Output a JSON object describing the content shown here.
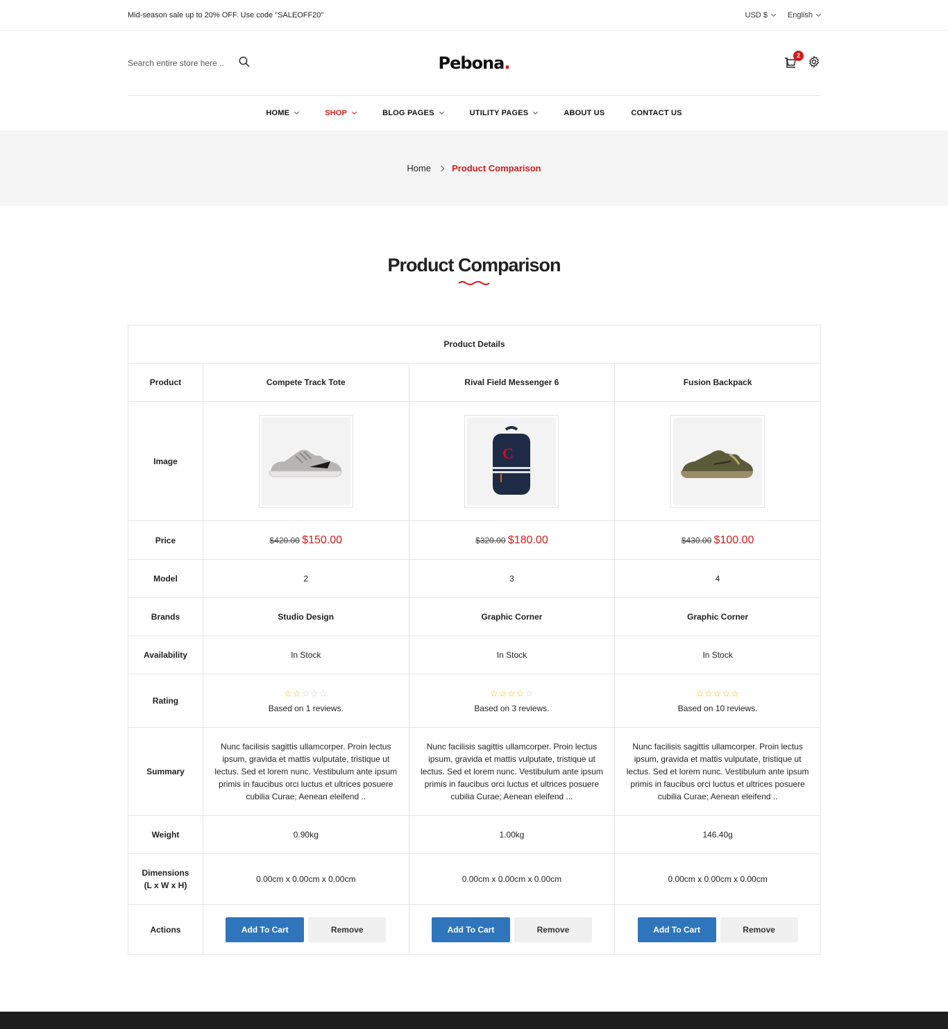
{
  "topbar": {
    "promo": "Mid-season sale up to 20% OFF. Use code \"SALEOFF20\"",
    "currency": "USD $",
    "language": "English"
  },
  "header": {
    "search_placeholder": "Search entire store here ...",
    "logo_text": "Pebona",
    "logo_dot": ".",
    "cart_count": "2"
  },
  "nav": {
    "items": [
      {
        "label": "HOME"
      },
      {
        "label": "SHOP"
      },
      {
        "label": "BLOG PAGES"
      },
      {
        "label": "UTILITY PAGES"
      },
      {
        "label": "ABOUT US"
      },
      {
        "label": "CONTACT US"
      }
    ]
  },
  "breadcrumb": {
    "home": "Home",
    "current": "Product Comparison"
  },
  "page": {
    "title": "Product Comparison"
  },
  "table": {
    "heading": "Product Details",
    "labels": {
      "product": "Product",
      "image": "Image",
      "price": "Price",
      "model": "Model",
      "brands": "Brands",
      "availability": "Availability",
      "rating": "Rating",
      "summary": "Summary",
      "weight": "Weight",
      "dimensions_1": "Dimensions",
      "dimensions_2": "(L x W x H)",
      "actions": "Actions"
    },
    "products": [
      {
        "name": "Compete Track Tote",
        "image": "grey-sneaker",
        "old_price": "$420.00",
        "price": "$150.00",
        "model": "2",
        "brand": "Studio Design",
        "availability": "In Stock",
        "rating": 2,
        "reviews": "Based on 1 reviews.",
        "summary": "Nunc facilisis sagittis ullamcorper. Proin lectus ipsum, gravida et mattis vulputate, tristique ut lectus. Sed et lorem nunc. Vestibulum ante ipsum primis in faucibus orci luctus et ultrices posuere cubilia Curae; Aenean eleifend ..",
        "weight": "0.90kg",
        "dimensions": "0.00cm x 0.00cm x 0.00cm",
        "add_label": "Add To Cart",
        "remove_label": "Remove"
      },
      {
        "name": "Rival Field Messenger 6",
        "image": "navy-backpack",
        "old_price": "$320.00",
        "price": "$180.00",
        "model": "3",
        "brand": "Graphic Corner",
        "availability": "In Stock",
        "rating": 4,
        "reviews": "Based on 3 reviews.",
        "summary": "Nunc facilisis sagittis ullamcorper. Proin lectus ipsum, gravida et mattis vulputate, tristique ut lectus. Sed et lorem nunc. Vestibulum ante ipsum primis in faucibus orci luctus et ultrices posuere cubilia Curae; Aenean eleifend ...",
        "weight": "1.00kg",
        "dimensions": "0.00cm x 0.00cm x 0.00cm",
        "add_label": "Add To Cart",
        "remove_label": "Remove"
      },
      {
        "name": "Fusion Backpack",
        "image": "olive-sneaker",
        "old_price": "$430.00",
        "price": "$100.00",
        "model": "4",
        "brand": "Graphic Corner",
        "availability": "In Stock",
        "rating": 5,
        "reviews": "Based on 10 reviews.",
        "summary": "Nunc facilisis sagittis ullamcorper. Proin lectus ipsum, gravida et mattis vulputate, tristique ut lectus. Sed et lorem nunc. Vestibulum ante ipsum primis in faucibus orci luctus et ultrices posuere cubilia Curae; Aenean eleifend ..",
        "weight": "146.40g",
        "dimensions": "0.00cm x 0.00cm x 0.00cm",
        "add_label": "Add To Cart",
        "remove_label": "Remove"
      }
    ]
  },
  "colors": {
    "accent": "#d21b1b",
    "button_primary": "#2f75bc",
    "star": "#f0b400"
  }
}
